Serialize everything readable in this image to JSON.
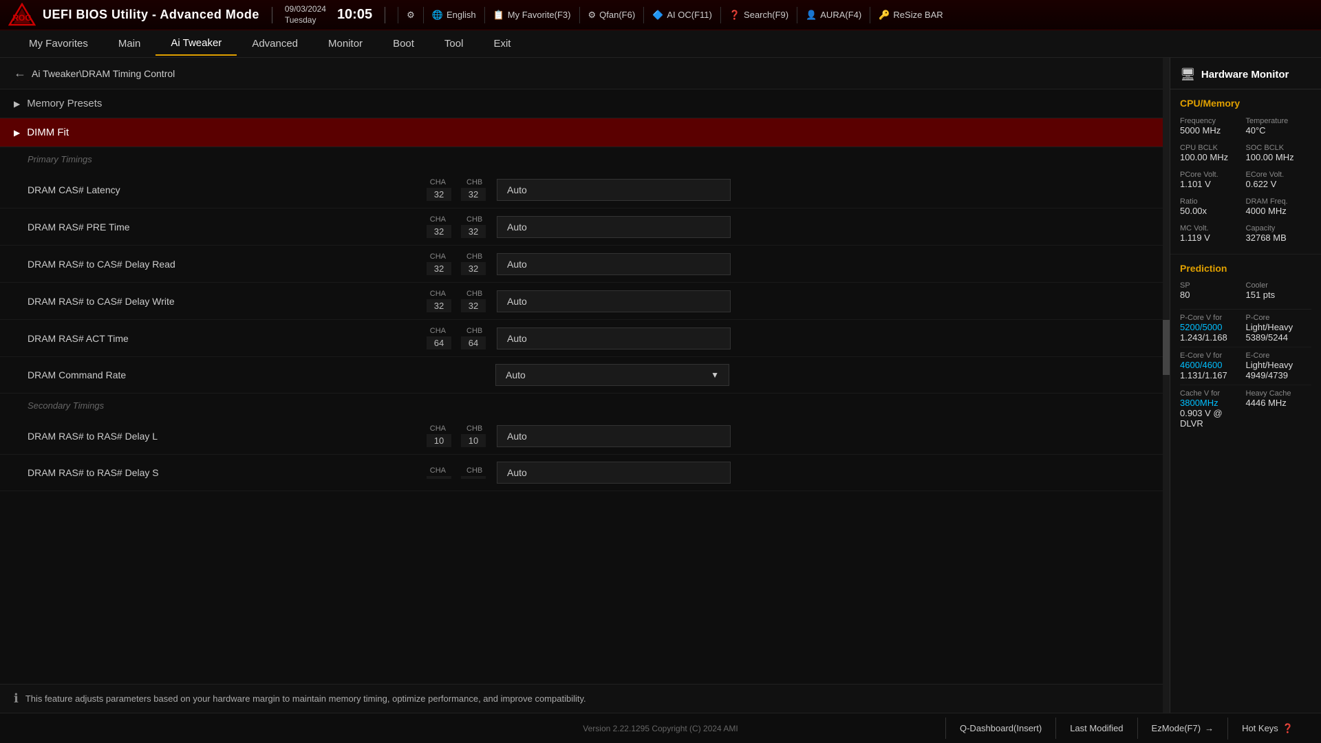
{
  "header": {
    "title": "UEFI BIOS Utility - Advanced Mode",
    "date": "09/03/2024",
    "day": "Tuesday",
    "time": "10:05",
    "toolbar": [
      {
        "id": "settings",
        "icon": "⚙",
        "label": ""
      },
      {
        "id": "english",
        "icon": "🌐",
        "label": "English"
      },
      {
        "id": "my-favorite",
        "icon": "📋",
        "label": "My Favorite(F3)"
      },
      {
        "id": "qfan",
        "icon": "⚙",
        "label": "Qfan(F6)"
      },
      {
        "id": "ai-oc",
        "icon": "🔷",
        "label": "AI OC(F11)"
      },
      {
        "id": "search",
        "icon": "❓",
        "label": "Search(F9)"
      },
      {
        "id": "aura",
        "icon": "👤",
        "label": "AURA(F4)"
      },
      {
        "id": "resize-bar",
        "icon": "🔑",
        "label": "ReSize BAR"
      }
    ]
  },
  "nav": {
    "items": [
      {
        "id": "my-favorites",
        "label": "My Favorites"
      },
      {
        "id": "main",
        "label": "Main"
      },
      {
        "id": "ai-tweaker",
        "label": "Ai Tweaker",
        "active": true
      },
      {
        "id": "advanced",
        "label": "Advanced"
      },
      {
        "id": "monitor",
        "label": "Monitor"
      },
      {
        "id": "boot",
        "label": "Boot"
      },
      {
        "id": "tool",
        "label": "Tool"
      },
      {
        "id": "exit",
        "label": "Exit"
      }
    ]
  },
  "breadcrumb": {
    "text": "Ai Tweaker\\DRAM Timing Control"
  },
  "sections": [
    {
      "id": "memory-presets",
      "label": "Memory Presets",
      "expanded": false
    },
    {
      "id": "dimm-fit",
      "label": "DIMM Fit",
      "expanded": true,
      "active": true
    }
  ],
  "primary_timings_label": "Primary Timings",
  "secondary_timings_label": "Secondary Timings",
  "settings": [
    {
      "id": "dram-cas-latency",
      "name": "DRAM CAS# Latency",
      "cha_label": "CHA",
      "chb_label": "CHB",
      "cha_val": "32",
      "chb_val": "32",
      "control": "Auto",
      "type": "box",
      "section": "primary"
    },
    {
      "id": "dram-ras-pre-time",
      "name": "DRAM RAS# PRE Time",
      "cha_label": "CHA",
      "chb_label": "CHB",
      "cha_val": "32",
      "chb_val": "32",
      "control": "Auto",
      "type": "box",
      "section": "primary"
    },
    {
      "id": "dram-ras-to-cas-read",
      "name": "DRAM RAS# to CAS# Delay Read",
      "cha_label": "CHA",
      "chb_label": "CHB",
      "cha_val": "32",
      "chb_val": "32",
      "control": "Auto",
      "type": "box",
      "section": "primary"
    },
    {
      "id": "dram-ras-to-cas-write",
      "name": "DRAM RAS# to CAS# Delay Write",
      "cha_label": "CHA",
      "chb_label": "CHB",
      "cha_val": "32",
      "chb_val": "32",
      "control": "Auto",
      "type": "box",
      "section": "primary"
    },
    {
      "id": "dram-ras-act-time",
      "name": "DRAM RAS# ACT Time",
      "cha_label": "CHA",
      "chb_label": "CHB",
      "cha_val": "64",
      "chb_val": "64",
      "control": "Auto",
      "type": "box",
      "section": "primary"
    },
    {
      "id": "dram-command-rate",
      "name": "DRAM Command Rate",
      "cha_label": "",
      "chb_label": "",
      "cha_val": "",
      "chb_val": "",
      "control": "Auto",
      "type": "dropdown",
      "section": "primary"
    },
    {
      "id": "dram-ras-to-ras-l",
      "name": "DRAM RAS# to RAS# Delay L",
      "cha_label": "CHA",
      "chb_label": "CHB",
      "cha_val": "10",
      "chb_val": "10",
      "control": "Auto",
      "type": "box",
      "section": "secondary"
    },
    {
      "id": "dram-ras-to-ras-s",
      "name": "DRAM RAS# to RAS# Delay S",
      "cha_label": "CHA",
      "chb_label": "CHB",
      "cha_val": "",
      "chb_val": "",
      "control": "Auto",
      "type": "box",
      "section": "secondary",
      "partial": true
    }
  ],
  "info_text": "This feature adjusts parameters based on your hardware margin to maintain memory timing, optimize performance, and improve compatibility.",
  "hardware_monitor": {
    "title": "Hardware Monitor",
    "cpu_memory_label": "CPU/Memory",
    "items": [
      {
        "label": "Frequency",
        "value": "5000 MHz"
      },
      {
        "label": "Temperature",
        "value": "40°C"
      },
      {
        "label": "CPU BCLK",
        "value": "100.00 MHz"
      },
      {
        "label": "SOC BCLK",
        "value": "100.00 MHz"
      },
      {
        "label": "PCore Volt.",
        "value": "1.101 V"
      },
      {
        "label": "ECore Volt.",
        "value": "0.622 V"
      },
      {
        "label": "Ratio",
        "value": "50.00x"
      },
      {
        "label": "DRAM Freq.",
        "value": "4000 MHz"
      },
      {
        "label": "MC Volt.",
        "value": "1.119 V"
      },
      {
        "label": "Capacity",
        "value": "32768 MB"
      }
    ],
    "prediction_label": "Prediction",
    "prediction": {
      "sp_label": "SP",
      "sp_value": "80",
      "cooler_label": "Cooler",
      "cooler_value": "151 pts",
      "pcore_v_label": "P-Core V for",
      "pcore_v_freq": "5200/5000",
      "pcore_v_vals": "1.243/1.168",
      "pcore_lh_label": "P-Core",
      "pcore_lh_vals": "Light/Heavy",
      "pcore_lh_extra": "5389/5244",
      "ecore_v_label": "E-Core V for",
      "ecore_v_freq": "4600/4600",
      "ecore_v_vals": "1.131/1.167",
      "ecore_lh_label": "E-Core",
      "ecore_lh_vals": "Light/Heavy",
      "ecore_lh_extra": "4949/4739",
      "cache_v_label": "Cache V for",
      "cache_v_freq": "3800MHz",
      "cache_v_val": "0.903 V @ DLVR",
      "cache_lh_label": "Heavy Cache",
      "cache_lh_val": "4446 MHz"
    }
  },
  "footer": {
    "version": "Version 2.22.1295 Copyright (C) 2024 AMI",
    "buttons": [
      {
        "id": "q-dashboard",
        "label": "Q-Dashboard(Insert)"
      },
      {
        "id": "last-modified",
        "label": "Last Modified"
      },
      {
        "id": "ez-mode",
        "label": "EzMode(F7)"
      },
      {
        "id": "hot-keys",
        "label": "Hot Keys"
      }
    ]
  }
}
